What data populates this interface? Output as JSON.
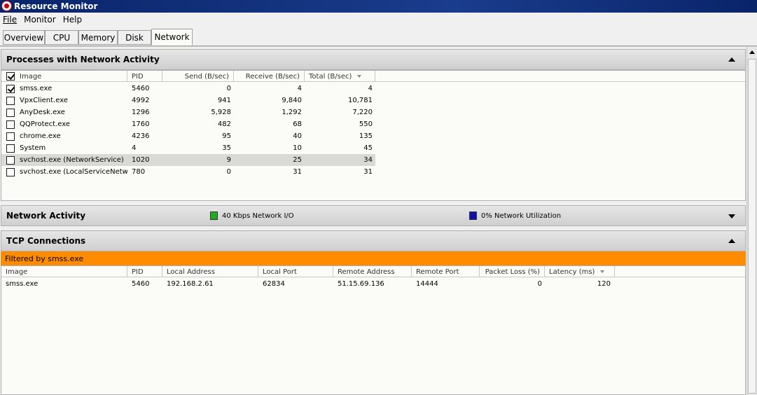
{
  "window": {
    "title": "Resource Monitor"
  },
  "menu": [
    "File",
    "Monitor",
    "Help"
  ],
  "tabs": [
    "Overview",
    "CPU",
    "Memory",
    "Disk",
    "Network"
  ],
  "processes": {
    "title": "Processes with Network Activity",
    "columns": {
      "image": "Image",
      "pid": "PID",
      "send": "Send (B/sec)",
      "receive": "Receive (B/sec)",
      "total": "Total (B/sec)"
    },
    "rows": [
      {
        "image": "smss.exe",
        "pid": "5460",
        "send": "0",
        "receive": "4",
        "total": "4",
        "checked": true
      },
      {
        "image": "VpxClient.exe",
        "pid": "4992",
        "send": "941",
        "receive": "9,840",
        "total": "10,781",
        "checked": false
      },
      {
        "image": "AnyDesk.exe",
        "pid": "1296",
        "send": "5,928",
        "receive": "1,292",
        "total": "7,220",
        "checked": false
      },
      {
        "image": "QQProtect.exe",
        "pid": "1760",
        "send": "482",
        "receive": "68",
        "total": "550",
        "checked": false
      },
      {
        "image": "chrome.exe",
        "pid": "4236",
        "send": "95",
        "receive": "40",
        "total": "135",
        "checked": false
      },
      {
        "image": "System",
        "pid": "4",
        "send": "35",
        "receive": "10",
        "total": "45",
        "checked": false
      },
      {
        "image": "svchost.exe (NetworkService)",
        "pid": "1020",
        "send": "9",
        "receive": "25",
        "total": "34",
        "checked": false,
        "selected": true
      },
      {
        "image": "svchost.exe (LocalServiceNetwo...",
        "pid": "780",
        "send": "0",
        "receive": "31",
        "total": "31",
        "checked": false
      }
    ]
  },
  "network_activity": {
    "title": "Network Activity",
    "io_label": "40 Kbps Network I/O",
    "io_color": "#22aa22",
    "util_label": "0% Network Utilization",
    "util_color": "#1010b0"
  },
  "tcp": {
    "title": "TCP Connections",
    "filter": "Filtered by smss.exe",
    "columns": {
      "image": "Image",
      "pid": "PID",
      "local_address": "Local Address",
      "local_port": "Local Port",
      "remote_address": "Remote Address",
      "remote_port": "Remote Port",
      "packet_loss": "Packet Loss (%)",
      "latency": "Latency (ms)"
    },
    "rows": [
      {
        "image": "smss.exe",
        "pid": "5460",
        "local_address": "192.168.2.61",
        "local_port": "62834",
        "remote_address": "51.15.69.136",
        "remote_port": "14444",
        "packet_loss": "0",
        "latency": "120"
      }
    ]
  }
}
